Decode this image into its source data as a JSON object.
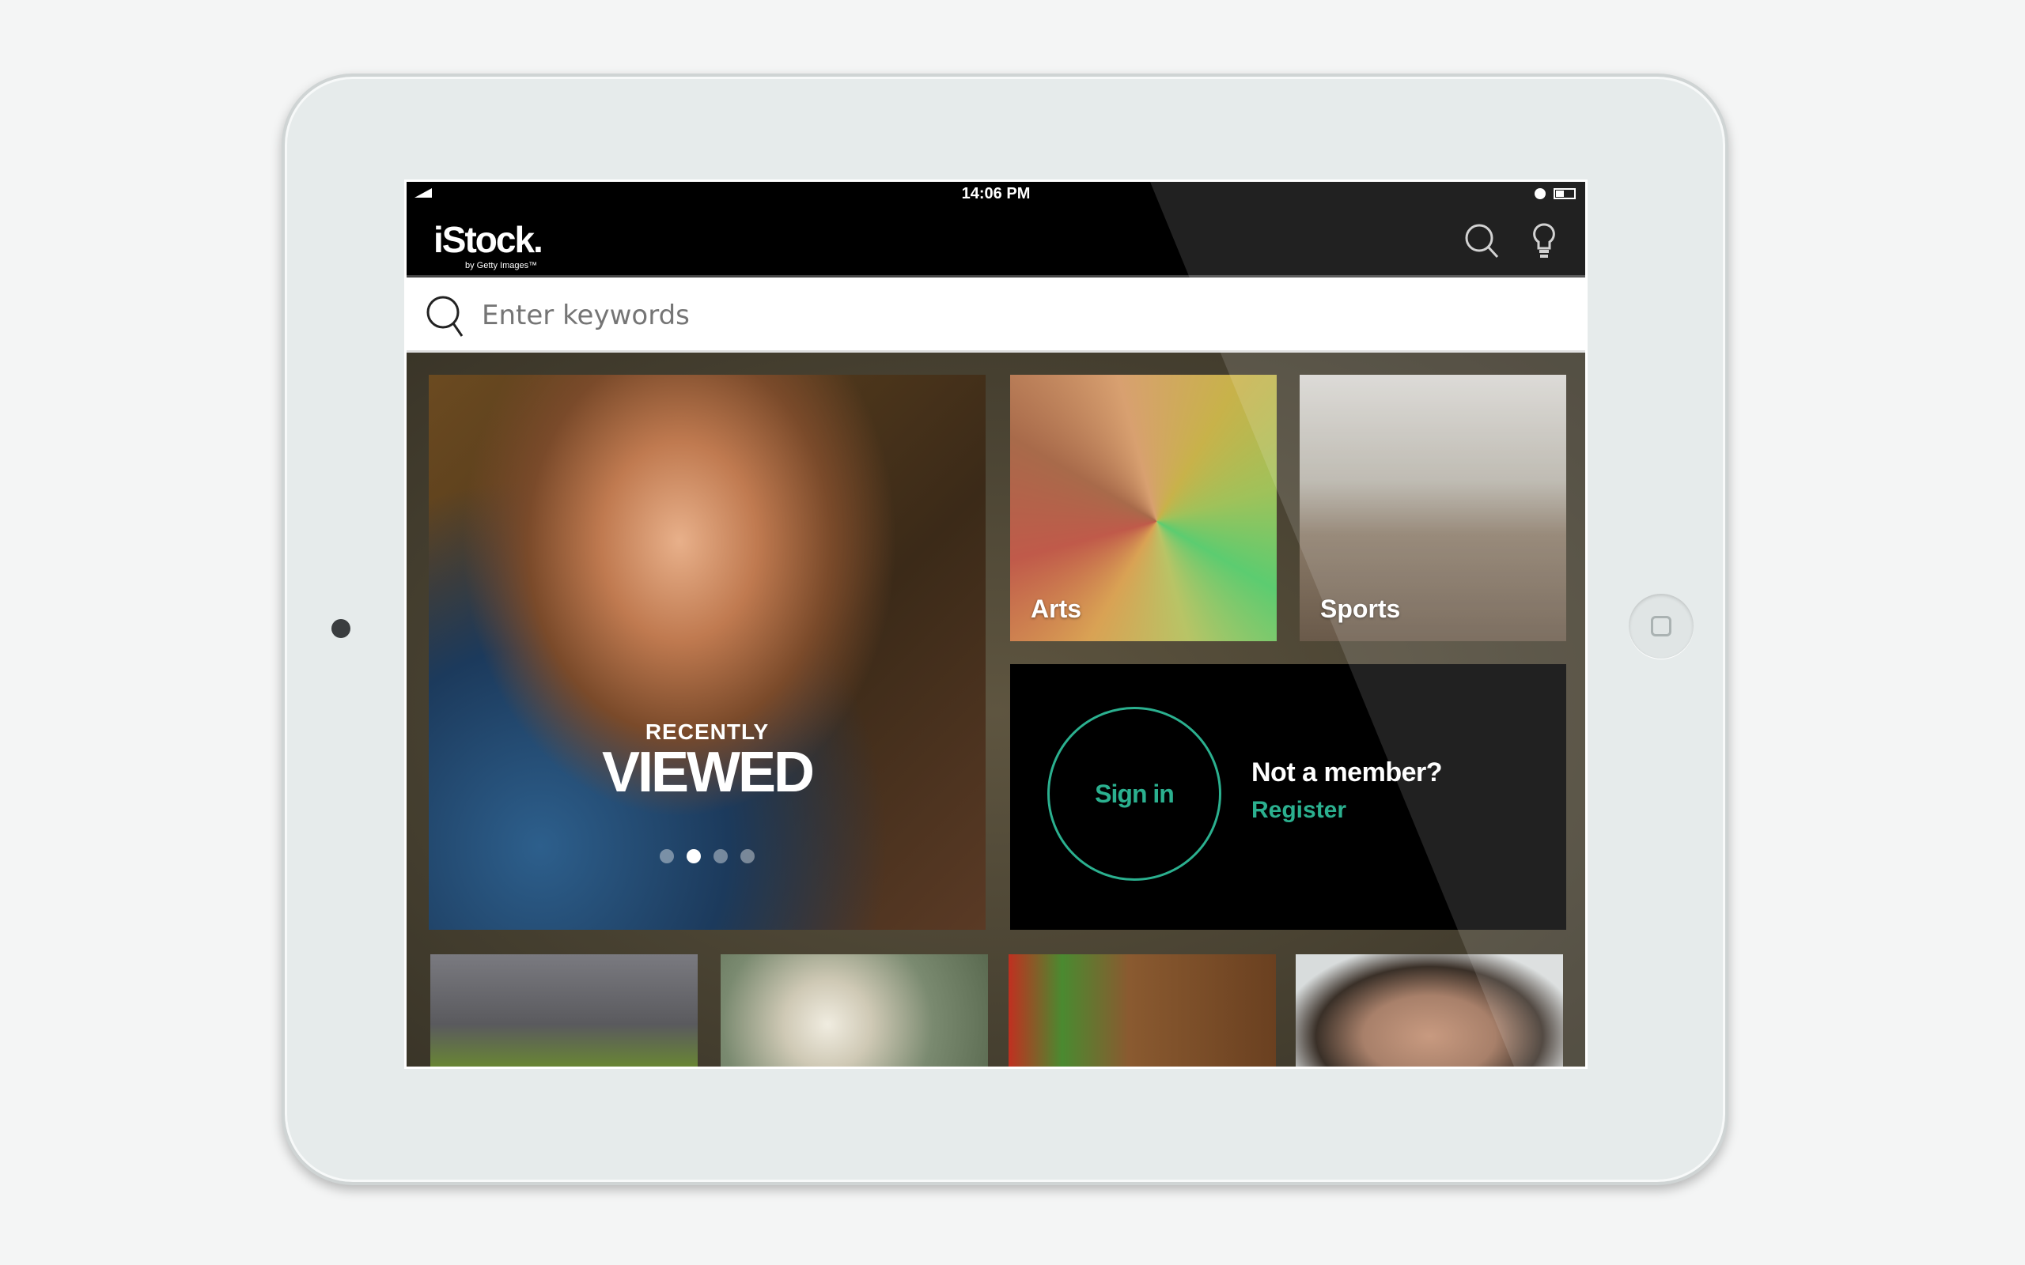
{
  "status_bar": {
    "time": "14:06 PM"
  },
  "header": {
    "logo_name": "iStock.",
    "logo_sub": "by Getty Images™"
  },
  "search": {
    "placeholder": "Enter keywords",
    "value": ""
  },
  "hero": {
    "line1": "RECENTLY",
    "line2": "VIEWED",
    "carousel_pages": 4,
    "carousel_active": 2
  },
  "categories": [
    {
      "label": "Arts"
    },
    {
      "label": "Sports"
    }
  ],
  "account": {
    "sign_in": "Sign in",
    "not_member": "Not a member?",
    "register": "Register"
  },
  "colors": {
    "accent": "#2bb08f",
    "header_bg": "#000000"
  }
}
